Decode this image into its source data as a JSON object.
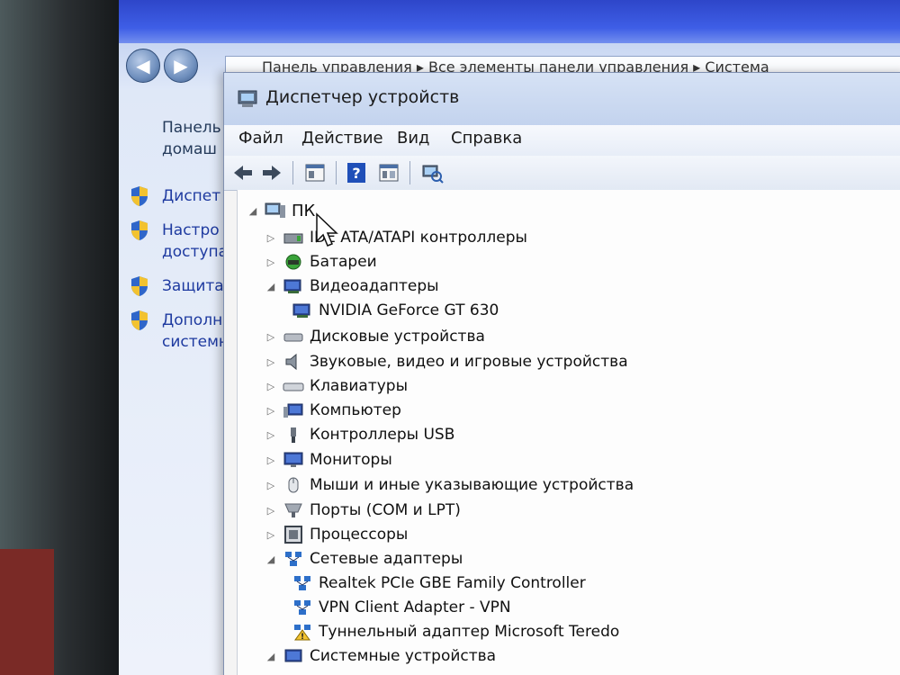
{
  "control_panel": {
    "address": "Панель управления ▸ Все элементы панели управления ▸ Система",
    "heading_line1": "Панель",
    "heading_line2": "домаш",
    "links": [
      "Диспет",
      "Настро",
      "доступа",
      "Защита",
      "Дополн",
      "системн"
    ]
  },
  "device_manager": {
    "title": "Диспетчер устройств",
    "menu": [
      "Файл",
      "Действие",
      "Вид",
      "Справка"
    ],
    "toolbar": {
      "back_icon": "arrow-left-icon",
      "forward_icon": "arrow-right-icon",
      "properties_icon": "properties-icon",
      "help_icon": "help-icon",
      "view_icon": "view-icon",
      "scan_icon": "scan-hardware-icon"
    },
    "tree": {
      "root": "ПК",
      "items": [
        {
          "label": "IDE ATA/ATAPI контроллеры",
          "expanded": false,
          "icon": "ide-controller-icon",
          "level": 1
        },
        {
          "label": "Батареи",
          "expanded": false,
          "icon": "battery-icon",
          "level": 1
        },
        {
          "label": "Видеоадаптеры",
          "expanded": true,
          "icon": "display-adapter-icon",
          "level": 1
        },
        {
          "label": "NVIDIA GeForce GT 630",
          "icon": "display-adapter-icon",
          "level": 2
        },
        {
          "label": "Дисковые устройства",
          "expanded": false,
          "icon": "disk-drive-icon",
          "level": 1
        },
        {
          "label": "Звуковые, видео и игровые устройства",
          "expanded": false,
          "icon": "speaker-icon",
          "level": 1
        },
        {
          "label": "Клавиатуры",
          "expanded": false,
          "icon": "keyboard-icon",
          "level": 1
        },
        {
          "label": "Компьютер",
          "expanded": false,
          "icon": "computer-icon",
          "level": 1
        },
        {
          "label": "Контроллеры USB",
          "expanded": false,
          "icon": "usb-icon",
          "level": 1
        },
        {
          "label": "Мониторы",
          "expanded": false,
          "icon": "monitor-icon",
          "level": 1
        },
        {
          "label": "Мыши и иные указывающие устройства",
          "expanded": false,
          "icon": "mouse-icon",
          "level": 1
        },
        {
          "label": "Порты (COM и LPT)",
          "expanded": false,
          "icon": "port-icon",
          "level": 1
        },
        {
          "label": "Процессоры",
          "expanded": false,
          "icon": "processor-icon",
          "level": 1
        },
        {
          "label": "Сетевые адаптеры",
          "expanded": true,
          "icon": "network-adapter-icon",
          "level": 1
        },
        {
          "label": "Realtek PCIe GBE Family Controller",
          "icon": "network-adapter-icon",
          "level": 2
        },
        {
          "label": "VPN Client Adapter - VPN",
          "icon": "network-adapter-icon",
          "level": 2
        },
        {
          "label": "Туннельный адаптер Microsoft Teredo",
          "icon": "warning-network-adapter-icon",
          "level": 2
        },
        {
          "label": "Системные устройства",
          "expanded": false,
          "icon": "system-device-icon",
          "level": 1
        }
      ]
    }
  }
}
